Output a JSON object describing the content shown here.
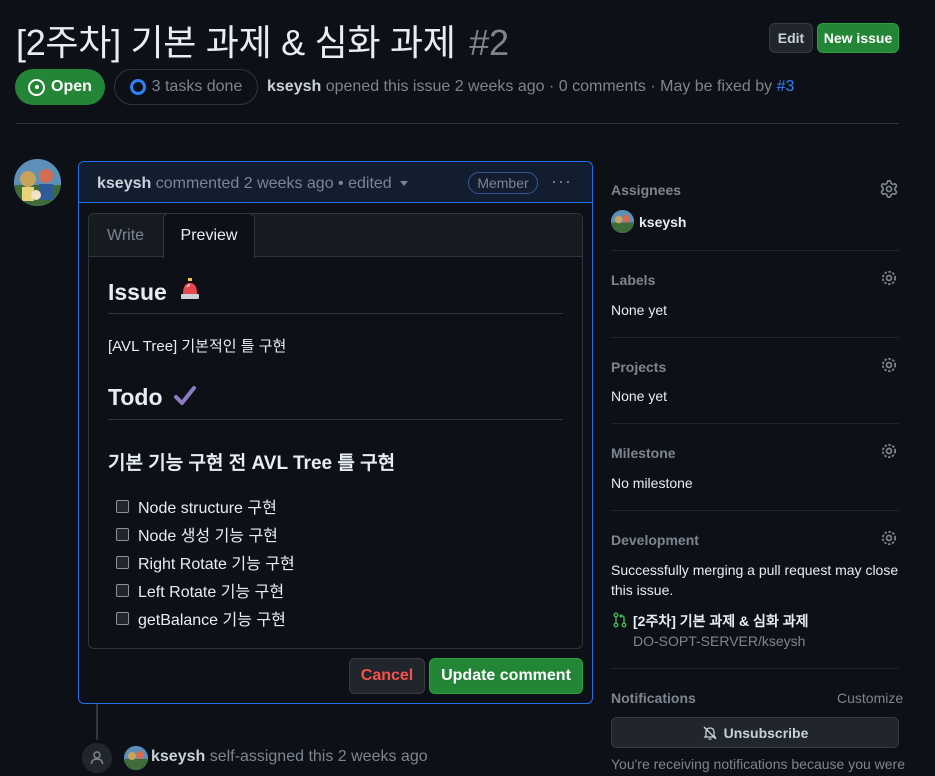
{
  "issue": {
    "title": "[2주차] 기본 과제 & 심화 과제",
    "number": "#2",
    "status": "Open",
    "tasks_done": "3 tasks done",
    "author": "kseysh",
    "meta_text": "opened this issue 2 weeks ago · 0 comments · May be fixed by",
    "fix_link": "#3"
  },
  "header": {
    "edit_label": "Edit",
    "new_issue_label": "New issue"
  },
  "comment": {
    "author": "kseysh",
    "meta": "commented 2 weeks ago • edited",
    "role_badge": "Member",
    "tabs": {
      "write": "Write",
      "preview": "Preview"
    },
    "body": {
      "h_issue": "Issue",
      "issue_emoji": "🚨",
      "issue_text": "[AVL Tree] 기본적인 틀 구현",
      "h_todo": "Todo",
      "todo_emoji": "✔",
      "h_sub": "기본 기능 구현 전 AVL Tree 틀 구현",
      "tasks": [
        {
          "label": "Node structure 구현",
          "checked": false
        },
        {
          "label": "Node 생성 기능 구현",
          "checked": false
        },
        {
          "label": "Right Rotate 기능 구현",
          "checked": false
        },
        {
          "label": "Left Rotate 기능 구현",
          "checked": false
        },
        {
          "label": "getBalance 기능 구현",
          "checked": false
        }
      ]
    },
    "cancel_label": "Cancel",
    "update_label": "Update comment"
  },
  "timeline_event": {
    "author": "kseysh",
    "text": "self-assigned this 2 weeks ago"
  },
  "sidebar": {
    "assignees": {
      "label": "Assignees",
      "value": "kseysh"
    },
    "labels": {
      "label": "Labels",
      "value": "None yet"
    },
    "projects": {
      "label": "Projects",
      "value": "None yet"
    },
    "milestone": {
      "label": "Milestone",
      "value": "No milestone"
    },
    "development": {
      "label": "Development",
      "text": "Successfully merging a pull request may close this issue.",
      "pr_title": "[2주차] 기본 과제 & 심화 과제",
      "pr_repo": "DO-SOPT-SERVER/kseysh"
    },
    "notifications": {
      "label": "Notifications",
      "customize": "Customize",
      "unsubscribe": "Unsubscribe",
      "note": "You're receiving notifications because you were"
    }
  },
  "colors": {
    "accent_blue": "#2f81f7",
    "open_green": "#238636",
    "danger": "#f85149",
    "bg": "#0d1117"
  }
}
